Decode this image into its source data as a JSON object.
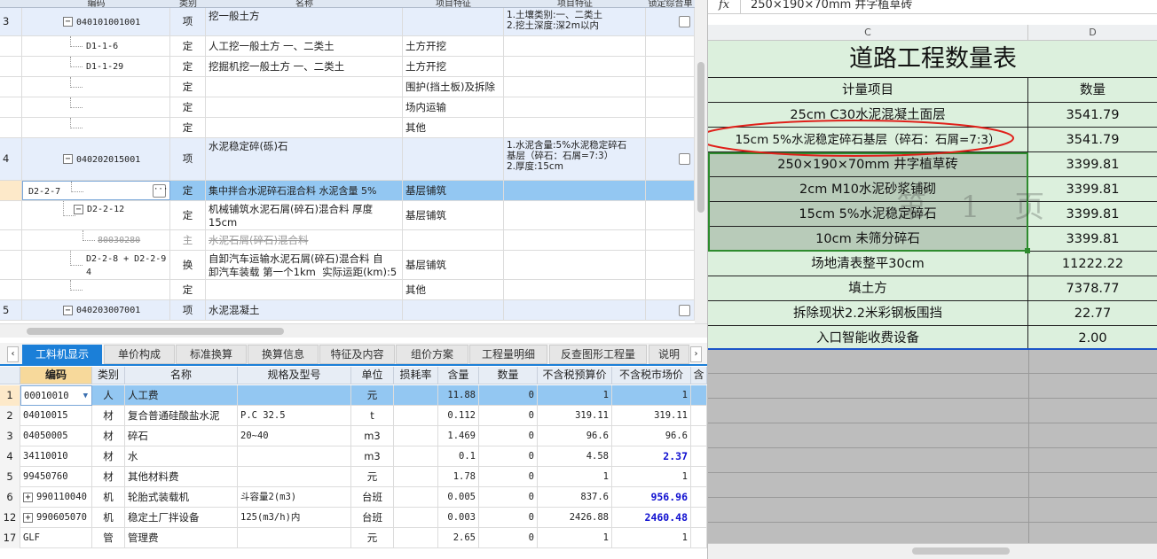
{
  "top_grid": {
    "headers": [
      "编码",
      "类别",
      "名称",
      "项目特征",
      "项目特征",
      "锁定综合单价"
    ],
    "rows": [
      {
        "no": "3",
        "code": "040101001001",
        "type": "项",
        "name": "挖一般土方",
        "content": "",
        "feature": "1.土壤类别:一、二类土\n2.挖土深度:深2m以内",
        "kind": "item"
      },
      {
        "no": "",
        "code": "D1-1-6",
        "type": "定",
        "name": "人工挖一般土方 一、二类土",
        "content": "土方开挖",
        "feature": "",
        "kind": "sub"
      },
      {
        "no": "",
        "code": "D1-1-29",
        "type": "定",
        "name": "挖掘机挖一般土方 一、二类土",
        "content": "土方开挖",
        "feature": "",
        "kind": "sub"
      },
      {
        "no": "",
        "code": "",
        "type": "定",
        "name": "",
        "content": "围护(挡土板)及拆除",
        "feature": "",
        "kind": "sub"
      },
      {
        "no": "",
        "code": "",
        "type": "定",
        "name": "",
        "content": "场内运输",
        "feature": "",
        "kind": "sub"
      },
      {
        "no": "",
        "code": "",
        "type": "定",
        "name": "",
        "content": "其他",
        "feature": "",
        "kind": "sub"
      },
      {
        "no": "4",
        "code": "040202015001",
        "type": "项",
        "name": "水泥稳定碎(砾)石",
        "content": "",
        "feature": "1.水泥含量:5%水泥稳定碎石\n基层（碎石：石屑=7:3）\n2.厚度:15cm",
        "kind": "item"
      },
      {
        "no": "",
        "code": "D2-2-7",
        "type": "定",
        "name": "集中拌合水泥碎石混合料 水泥含量 5%",
        "content": "基层铺筑",
        "feature": "",
        "kind": "selected"
      },
      {
        "no": "",
        "code": "D2-2-12",
        "type": "定",
        "name": "机械铺筑水泥石屑(碎石)混合料 厚度\n15cm",
        "content": "基层铺筑",
        "feature": "",
        "kind": "sub"
      },
      {
        "no": "",
        "code": "80030280",
        "type": "主",
        "name": "水泥石屑(碎石)混合料",
        "content": "",
        "feature": "",
        "kind": "strike"
      },
      {
        "no": "",
        "code": "D2-2-8 + D2-2-9 *\n4",
        "type": "换",
        "name": "自卸汽车运输水泥石屑(碎石)混合料 自\n卸汽车装载 第一个1km  实际运距(km):5",
        "content": "基层铺筑",
        "feature": "",
        "kind": "sub"
      },
      {
        "no": "",
        "code": "",
        "type": "定",
        "name": "",
        "content": "其他",
        "feature": "",
        "kind": "sub"
      },
      {
        "no": "5",
        "code": "040203007001",
        "type": "项",
        "name": "水泥混凝土",
        "content": "",
        "feature": "",
        "kind": "item"
      }
    ]
  },
  "tabs": [
    "工料机显示",
    "单价构成",
    "标准换算",
    "换算信息",
    "特征及内容",
    "组价方案",
    "工程量明细",
    "反查图形工程量",
    "说明"
  ],
  "bottom_grid": {
    "headers": [
      "编码",
      "类别",
      "名称",
      "规格及型号",
      "单位",
      "损耗率",
      "含量",
      "数量",
      "不含税预算价",
      "不含税市场价",
      "含"
    ],
    "rows": [
      {
        "no": "1",
        "code": "00010010",
        "type": "人",
        "name": "人工费",
        "spec": "",
        "unit": "元",
        "qty": "11.88",
        "amount": "0",
        "budget": "1",
        "market": "1",
        "hl": false,
        "expand": false
      },
      {
        "no": "2",
        "code": "04010015",
        "type": "材",
        "name": "复合普通硅酸盐水泥",
        "spec": "P.C 32.5",
        "unit": "t",
        "qty": "0.112",
        "amount": "0",
        "budget": "319.11",
        "market": "319.11",
        "hl": false,
        "expand": false
      },
      {
        "no": "3",
        "code": "04050005",
        "type": "材",
        "name": "碎石",
        "spec": "20~40",
        "unit": "m3",
        "qty": "1.469",
        "amount": "0",
        "budget": "96.6",
        "market": "96.6",
        "hl": false,
        "expand": false
      },
      {
        "no": "4",
        "code": "34110010",
        "type": "材",
        "name": "水",
        "spec": "",
        "unit": "m3",
        "qty": "0.1",
        "amount": "0",
        "budget": "4.58",
        "market": "2.37",
        "hl": true,
        "expand": false
      },
      {
        "no": "5",
        "code": "99450760",
        "type": "材",
        "name": "其他材料费",
        "spec": "",
        "unit": "元",
        "qty": "1.78",
        "amount": "0",
        "budget": "1",
        "market": "1",
        "hl": false,
        "expand": false
      },
      {
        "no": "6",
        "code": "990110040",
        "type": "机",
        "name": "轮胎式装载机",
        "spec": "斗容量2(m3)",
        "unit": "台班",
        "qty": "0.005",
        "amount": "0",
        "budget": "837.6",
        "market": "956.96",
        "hl": true,
        "expand": true
      },
      {
        "no": "12",
        "code": "990605070",
        "type": "机",
        "name": "稳定土厂拌设备",
        "spec": "125(m3/h)内",
        "unit": "台班",
        "qty": "0.003",
        "amount": "0",
        "budget": "2426.88",
        "market": "2460.48",
        "hl": true,
        "expand": true
      },
      {
        "no": "17",
        "code": "GLF",
        "type": "管",
        "name": "管理费",
        "spec": "",
        "unit": "元",
        "qty": "2.65",
        "amount": "0",
        "budget": "1",
        "market": "1",
        "hl": false,
        "expand": false
      }
    ]
  },
  "sheet": {
    "fx_label": "fx",
    "formula": "250×190×70mm 井字植草砖",
    "col_c": "C",
    "col_d": "D",
    "title": "道路工程数量表",
    "head_item": "计量项目",
    "head_qty": "数量",
    "watermark": "第 1 页",
    "rows": [
      {
        "item": "25cm C30水泥混凝土面层",
        "qty": "3541.79"
      },
      {
        "item": "15cm 5%水泥稳定碎石基层（碎石：石屑=7:3）",
        "qty": "3541.79"
      },
      {
        "item": "250×190×70mm 井字植草砖",
        "qty": "3399.81"
      },
      {
        "item": "2cm M10水泥砂浆铺砌",
        "qty": "3399.81"
      },
      {
        "item": "15cm 5%水泥稳定碎石",
        "qty": "3399.81"
      },
      {
        "item": "10cm 未筛分碎石",
        "qty": "3399.81"
      },
      {
        "item": "场地清表整平30cm",
        "qty": "11222.22"
      },
      {
        "item": "填土方",
        "qty": "7378.77"
      },
      {
        "item": "拆除现状2.2米彩钢板围挡",
        "qty": "22.77"
      },
      {
        "item": "入口智能收费设备",
        "qty": "2.00"
      }
    ],
    "colors": {
      "cell_bg": "#dcf0dd",
      "highlight_ring": "#e0201a",
      "selection": "#2e8b2e"
    }
  }
}
